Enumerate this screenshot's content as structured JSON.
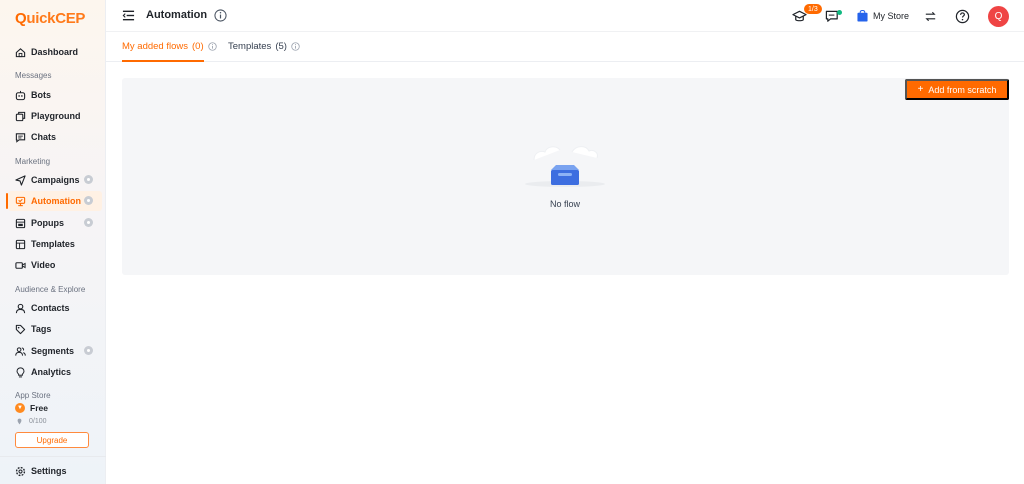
{
  "brand": {
    "logo_q": "Q",
    "logo_rest": "uickCEP"
  },
  "sidebar": {
    "dashboard": "Dashboard",
    "section_messages": "Messages",
    "bots": "Bots",
    "playground": "Playground",
    "chats": "Chats",
    "section_marketing": "Marketing",
    "campaigns": "Campaigns",
    "automation": "Automation",
    "popups": "Popups",
    "templates": "Templates",
    "video": "Video",
    "section_audience": "Audience & Explore",
    "contacts": "Contacts",
    "tags": "Tags",
    "segments": "Segments",
    "analytics": "Analytics",
    "section_appstore": "App Store",
    "plan_label": "Free",
    "quota": "0/100",
    "upgrade_label": "Upgrade",
    "settings": "Settings"
  },
  "header": {
    "title": "Automation",
    "onboarding_count": "1/3",
    "store_name": "My Store",
    "avatar_initial": "Q"
  },
  "tabs": {
    "my_flows": "My added flows",
    "my_flows_count": "(0)",
    "templates": "Templates",
    "templates_count": "(5)"
  },
  "main": {
    "add_button": "Add from scratch",
    "empty_text": "No flow"
  },
  "colors": {
    "accent": "#ff6a00",
    "avatar": "#ef4444",
    "panel": "#f5f6f8"
  }
}
